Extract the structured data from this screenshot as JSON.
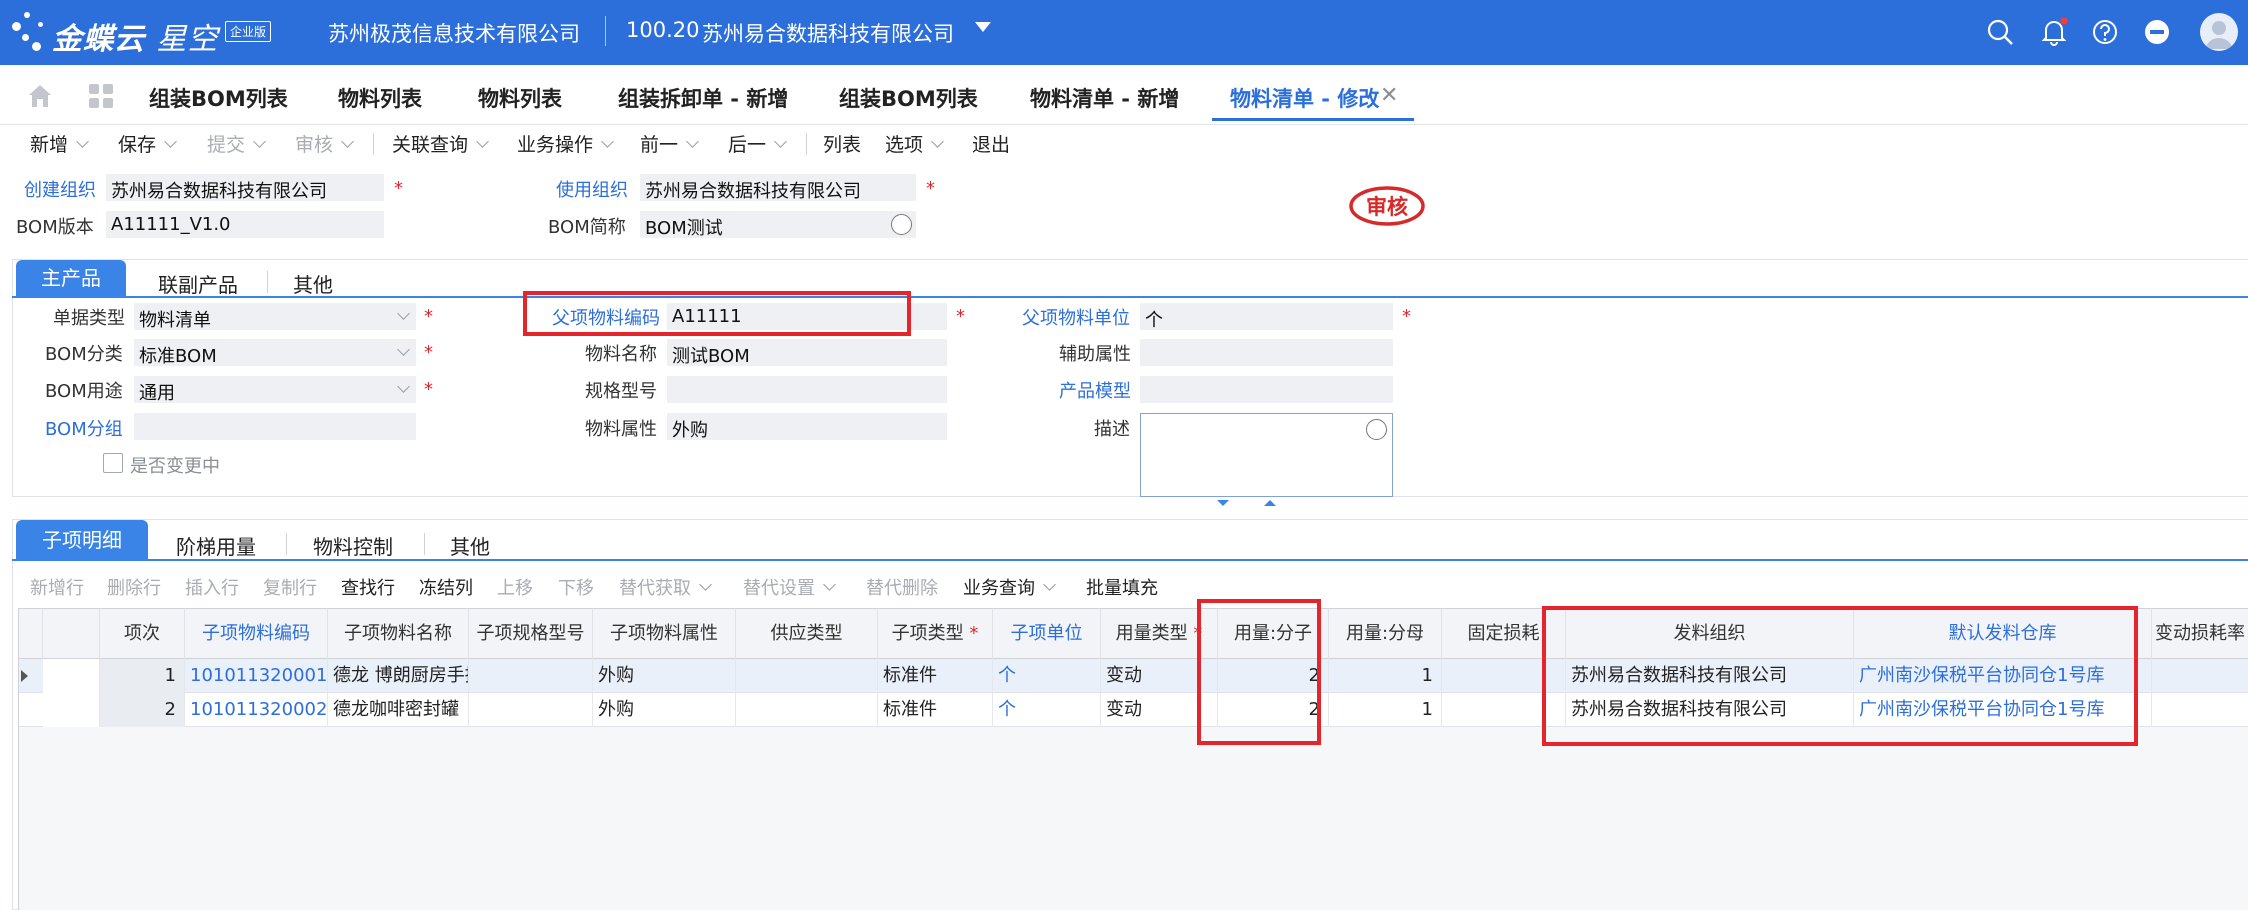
{
  "app": {
    "brand": "金蝶云",
    "product": "星空",
    "edition": "企业版",
    "company_left": "苏州极茂信息技术有限公司",
    "account_code": "100.20",
    "company_right": "苏州易合数据科技有限公司"
  },
  "tabs": [
    {
      "label": "组装BOM列表"
    },
    {
      "label": "物料列表"
    },
    {
      "label": "物料列表"
    },
    {
      "label": "组装拆卸单 - 新增"
    },
    {
      "label": "组装BOM列表"
    },
    {
      "label": "物料清单 - 新增"
    },
    {
      "label": "物料清单 - 修改",
      "active": true
    }
  ],
  "toolbar": {
    "new": "新增",
    "save": "保存",
    "submit": "提交",
    "audit": "审核",
    "related_query": "关联查询",
    "business_ops": "业务操作",
    "prev": "前一",
    "next": "后一",
    "list": "列表",
    "options": "选项",
    "exit": "退出"
  },
  "header": {
    "create_org_label": "创建组织",
    "create_org": "苏州易合数据科技有限公司",
    "use_org_label": "使用组织",
    "use_org": "苏州易合数据科技有限公司",
    "bom_version_label": "BOM版本",
    "bom_version": "A11111_V1.0",
    "bom_short_label": "BOM简称",
    "bom_short": "BOM测试",
    "stamp": "审核"
  },
  "main_tabs": {
    "main": "主产品",
    "co": "联副产品",
    "other": "其他"
  },
  "main_form": {
    "doc_type_label": "单据类型",
    "doc_type": "物料清单",
    "bom_class_label": "BOM分类",
    "bom_class": "标准BOM",
    "bom_use_label": "BOM用途",
    "bom_use": "通用",
    "bom_group_label": "BOM分组",
    "bom_group": "",
    "changing_label": "是否变更中",
    "parent_code_label": "父项物料编码",
    "parent_code": "A11111",
    "mat_name_label": "物料名称",
    "mat_name": "测试BOM",
    "spec_label": "规格型号",
    "spec": "",
    "mat_attr_label": "物料属性",
    "mat_attr": "外购",
    "parent_unit_label": "父项物料单位",
    "parent_unit": "个",
    "aux_attr_label": "辅助属性",
    "aux_attr": "",
    "product_model_label": "产品模型",
    "product_model": "",
    "desc_label": "描述"
  },
  "detail_tabs": {
    "items": "子项明细",
    "ladder": "阶梯用量",
    "control": "物料控制",
    "other": "其他"
  },
  "grid_toolbar": {
    "add_row": "新增行",
    "del_row": "删除行",
    "insert_row": "插入行",
    "copy_row": "复制行",
    "find_row": "查找行",
    "freeze": "冻结列",
    "up": "上移",
    "down": "下移",
    "alt_get": "替代获取",
    "alt_set": "替代设置",
    "alt_del": "替代删除",
    "biz_query": "业务查询",
    "batch_fill": "批量填充"
  },
  "grid": {
    "columns": [
      "项次",
      "子项物料编码",
      "子项物料名称",
      "子项规格型号",
      "子项物料属性",
      "供应类型",
      "子项类型",
      "子项单位",
      "用量类型",
      "用量:分子",
      "用量:分母",
      "固定损耗",
      "发料组织",
      "默认发料仓库",
      "变动损耗率"
    ],
    "rows": [
      {
        "seq": "1",
        "code": "101011320001",
        "name": "德龙 博朗厨房手持搅拌机",
        "spec": "",
        "attr": "外购",
        "supply": "",
        "type": "标准件",
        "unit": "个",
        "qty_type": "变动",
        "numerator": "2",
        "denominator": "1",
        "fixed_loss": "",
        "issue_org": "苏州易合数据科技有限公司",
        "warehouse": "广州南沙保税平台协同仓1号库",
        "var_loss": ""
      },
      {
        "seq": "2",
        "code": "101011320002",
        "name": "德龙咖啡密封罐",
        "spec": "",
        "attr": "外购",
        "supply": "",
        "type": "标准件",
        "unit": "个",
        "qty_type": "变动",
        "numerator": "2",
        "denominator": "1",
        "fixed_loss": "",
        "issue_org": "苏州易合数据科技有限公司",
        "warehouse": "广州南沙保税平台协同仓1号库",
        "var_loss": ""
      }
    ]
  },
  "colors": {
    "brand": "#2c6fdb",
    "highlight": "#e4262c",
    "required": "#e0262c"
  }
}
